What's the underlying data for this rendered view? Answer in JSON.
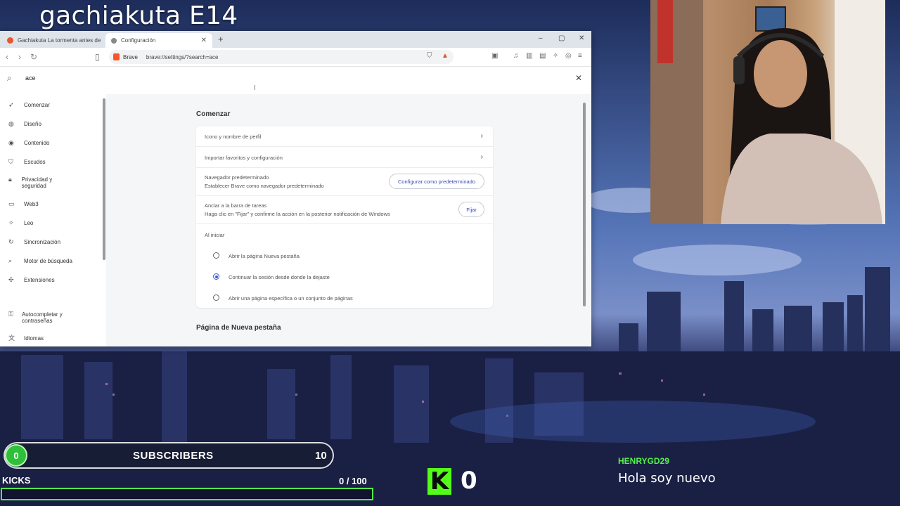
{
  "stream": {
    "title": "gachiakuta E14"
  },
  "browser": {
    "tabs": [
      {
        "label": "Gachiakuta La tormenta antes de la t"
      },
      {
        "label": "Configuración"
      }
    ],
    "new_tab": "+",
    "window_controls": [
      "–",
      "▢",
      "✕"
    ],
    "address": {
      "brand": "Brave",
      "url": "brave://settings/?search=ace"
    },
    "search": {
      "value": "ace"
    },
    "sidebar": [
      {
        "icon": "rocket-icon",
        "label": "Comenzar"
      },
      {
        "icon": "palette-icon",
        "label": "Diseño"
      },
      {
        "icon": "content-icon",
        "label": "Contenido"
      },
      {
        "icon": "shield-icon",
        "label": "Escudos"
      },
      {
        "icon": "lock-icon",
        "label": "Privacidad y seguridad"
      },
      {
        "icon": "wallet-icon",
        "label": "Web3"
      },
      {
        "icon": "leo-icon",
        "label": "Leo"
      },
      {
        "icon": "sync-icon",
        "label": "Sincronización"
      },
      {
        "icon": "search-icon",
        "label": "Motor de búsqueda"
      },
      {
        "icon": "puzzle-icon",
        "label": "Extensiones"
      },
      {
        "icon": "key-icon",
        "label": "Autocompletar y contraseñas"
      },
      {
        "icon": "translate-icon",
        "label": "Idiomas"
      }
    ],
    "main": {
      "section1": "Comenzar",
      "rows": {
        "profile": "Icono y nombre de perfil",
        "import": "Importar favoritos y configuración",
        "default_title": "Navegador predeterminado",
        "default_sub": "Establecer Brave como navegador predeterminado",
        "default_btn": "Configurar como predeterminado",
        "pin_title": "Anclar a la barra de tareas",
        "pin_sub": "Haga clic en \"Fijar\" y confirme la acción en la posterior notificación de Windows",
        "pin_btn": "Fijar",
        "startup_label": "Al iniciar"
      },
      "startup_options": [
        {
          "label": "Abrir la página Nueva pestaña",
          "selected": false
        },
        {
          "label": "Continuar la sesión desde donde la dejaste",
          "selected": true
        },
        {
          "label": "Abrir una página específica o un conjunto de páginas",
          "selected": false
        }
      ],
      "section2": "Página de Nueva pestaña"
    }
  },
  "overlay": {
    "subscribers": {
      "count": "0",
      "label": "SUBSCRIBERS",
      "goal": "10"
    },
    "kicks": {
      "label": "KICKS",
      "progress": "0 / 100",
      "fraction": 0
    },
    "kick_counter": {
      "logo": "K",
      "value": "0"
    },
    "chat": {
      "user": "HENRYGD29",
      "message": "Hola soy nuevo"
    }
  },
  "colors": {
    "kick_green": "#53fc18",
    "brave_orange": "#fb542b",
    "accent_blue": "#3b5bdb"
  }
}
